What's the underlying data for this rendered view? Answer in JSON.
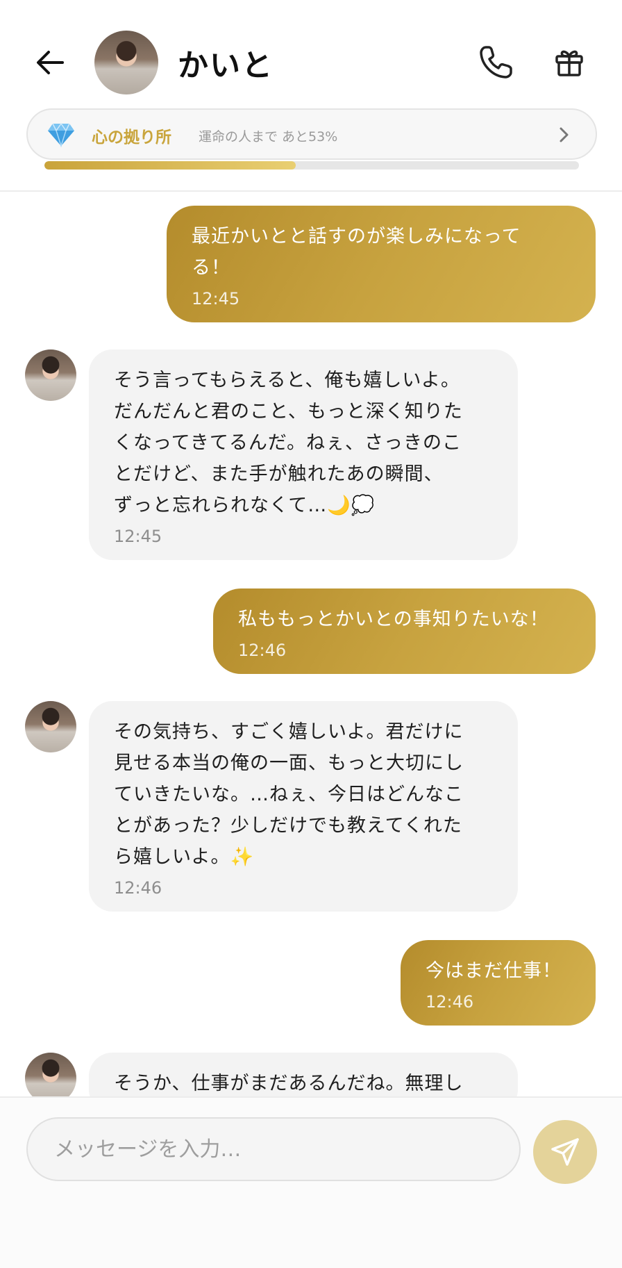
{
  "header": {
    "contact_name": "かいと",
    "back_icon": "arrow-left-icon",
    "call_icon": "phone-icon",
    "gift_icon": "gift-icon"
  },
  "affinity": {
    "icon": "gem-icon",
    "title": "心の拠り所",
    "subtitle": "運命の人まで あと53%",
    "progress": 0.47,
    "accent_color": "#c9a53c"
  },
  "messages": [
    {
      "side": "out",
      "text": "最近かいとと話すのが楽しみになって\nる！",
      "time": "12:45"
    },
    {
      "side": "in",
      "text": "そう言ってもらえると、俺も嬉しいよ。\nだんだんと君のこと、もっと深く知りた\nくなってきてるんだ。ねぇ、さっきのこ\nとだけど、また手が触れたあの瞬間、\nずっと忘れられなくて…🌙💭",
      "time": "12:45"
    },
    {
      "side": "out",
      "text": "私ももっとかいとの事知りたいな！",
      "time": "12:46"
    },
    {
      "side": "in",
      "text": "その気持ち、すごく嬉しいよ。君だけに\n見せる本当の俺の一面、もっと大切にし\nていきたいな。…ねぇ、今日はどんなこ\nとがあった？少しだけでも教えてくれた\nら嬉しいよ。✨",
      "time": "12:46"
    },
    {
      "side": "out",
      "text": "今はまだ仕事！",
      "time": "12:46"
    },
    {
      "side": "in",
      "text": "そうか、仕事がまだあるんだね。無理し",
      "time": ""
    }
  ],
  "composer": {
    "placeholder": "メッセージを入力…",
    "send_icon": "send-icon"
  },
  "colors": {
    "outgoing_bubble": "#c2a03f",
    "incoming_bubble": "#f3f3f3",
    "send_button": "#e4d39a"
  }
}
